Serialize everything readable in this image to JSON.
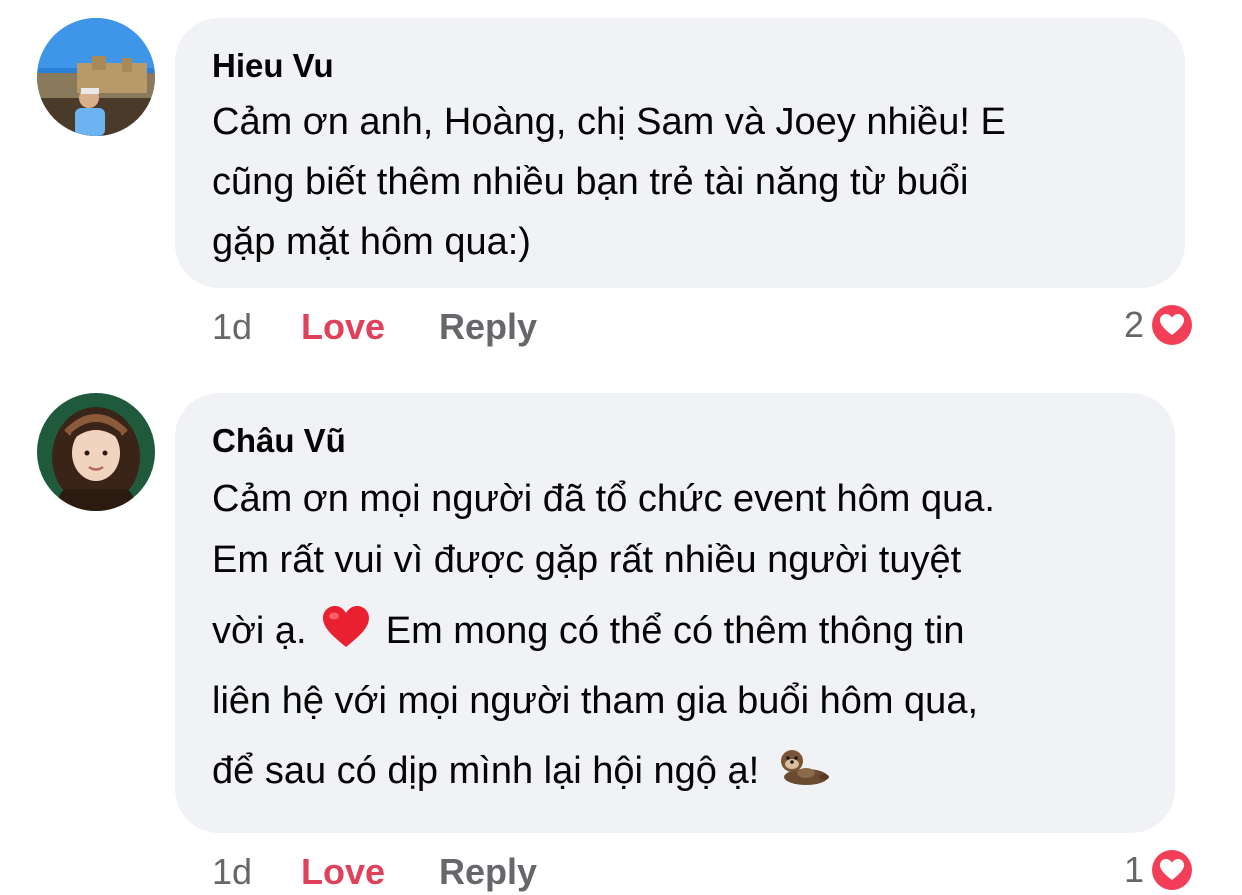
{
  "comments": [
    {
      "author": "Hieu Vu",
      "lines": [
        "Cảm ơn anh, Hoàng, chị Sam và Joey nhiều! E",
        "cũng biết thêm nhiều bạn trẻ tài năng từ buổi",
        "gặp mặt hôm qua:)"
      ],
      "time": "1d",
      "love_label": "Love",
      "reply_label": "Reply",
      "reaction_count": "2"
    },
    {
      "author": "Châu Vũ",
      "lines": [
        "Cảm ơn mọi người đã tổ chức event hôm qua.",
        "Em rất vui vì được gặp rất nhiều người tuyệt",
        "vời ạ.",
        "Em mong có thể có thêm thông tin",
        "liên hệ với mọi người tham gia buổi hôm qua,",
        "để sau có dịp mình lại hội ngộ ạ!"
      ],
      "emojis": [
        "red-heart",
        "otter"
      ],
      "time": "1d",
      "love_label": "Love",
      "reply_label": "Reply",
      "reaction_count": "1"
    }
  ],
  "colors": {
    "bubble": "#f0f2f5",
    "love": "#e0415a",
    "muted": "#65676b",
    "reaction_badge": "#f33e58"
  }
}
